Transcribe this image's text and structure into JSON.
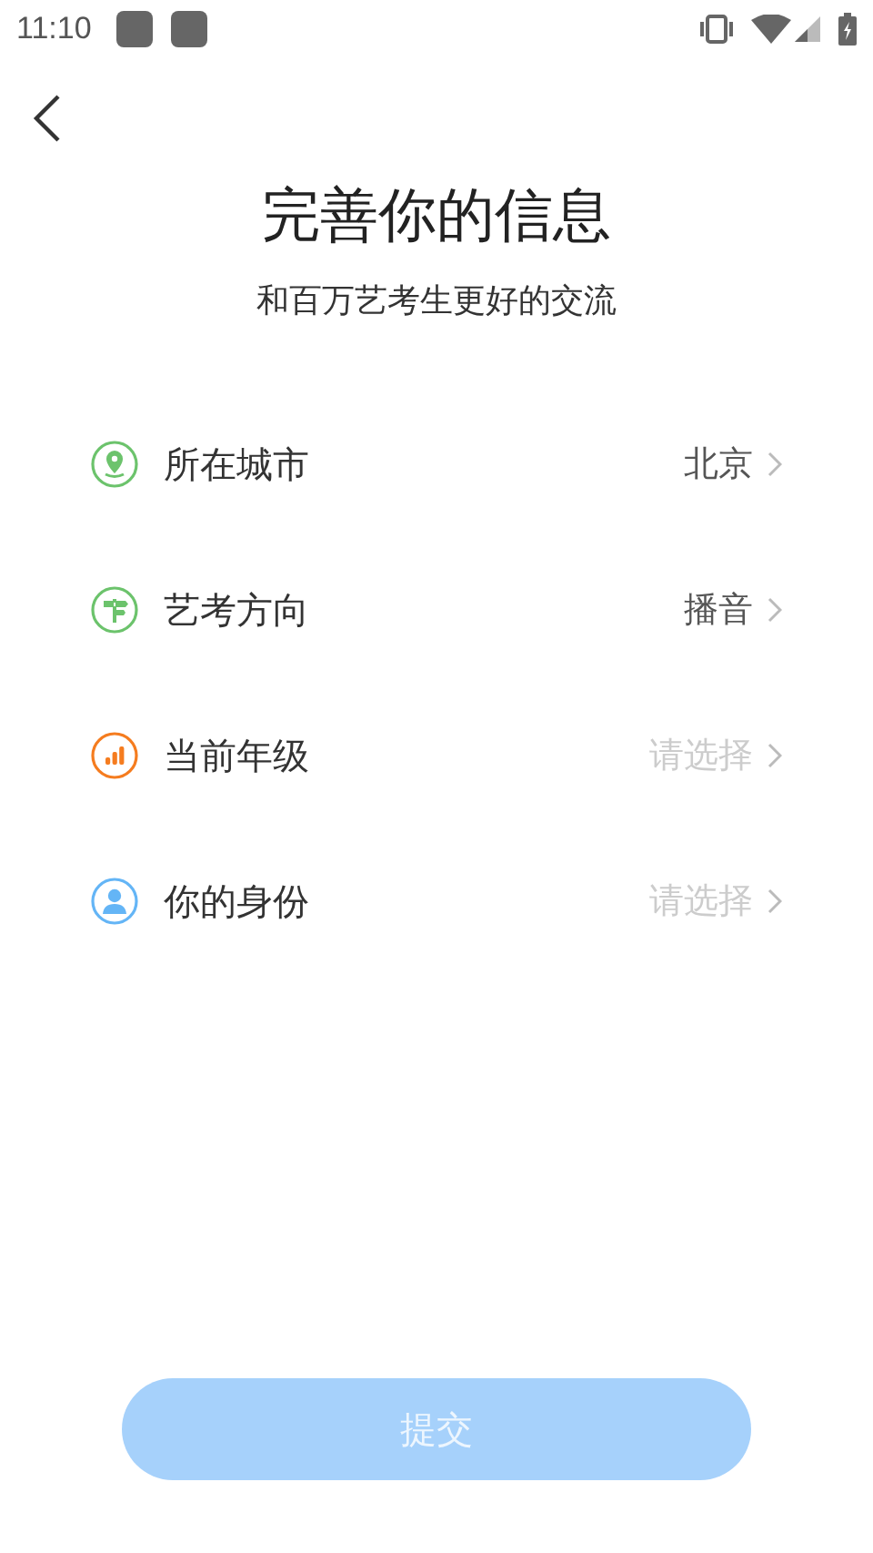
{
  "status_bar": {
    "time": "11:10"
  },
  "title": "完善你的信息",
  "subtitle": "和百万艺考生更好的交流",
  "rows": [
    {
      "kind": "location",
      "color": "#6cc36c",
      "label": "所在城市",
      "value": "北京"
    },
    {
      "kind": "signpost",
      "color": "#6cc36c",
      "label": "艺考方向",
      "value": "播音"
    },
    {
      "kind": "grade",
      "color": "#f57c1f",
      "label": "当前年级",
      "placeholder": "请选择"
    },
    {
      "kind": "person",
      "color": "#64b5f6",
      "label": "你的身份",
      "placeholder": "请选择"
    }
  ],
  "submit": {
    "label": "提交",
    "disabled": true
  }
}
